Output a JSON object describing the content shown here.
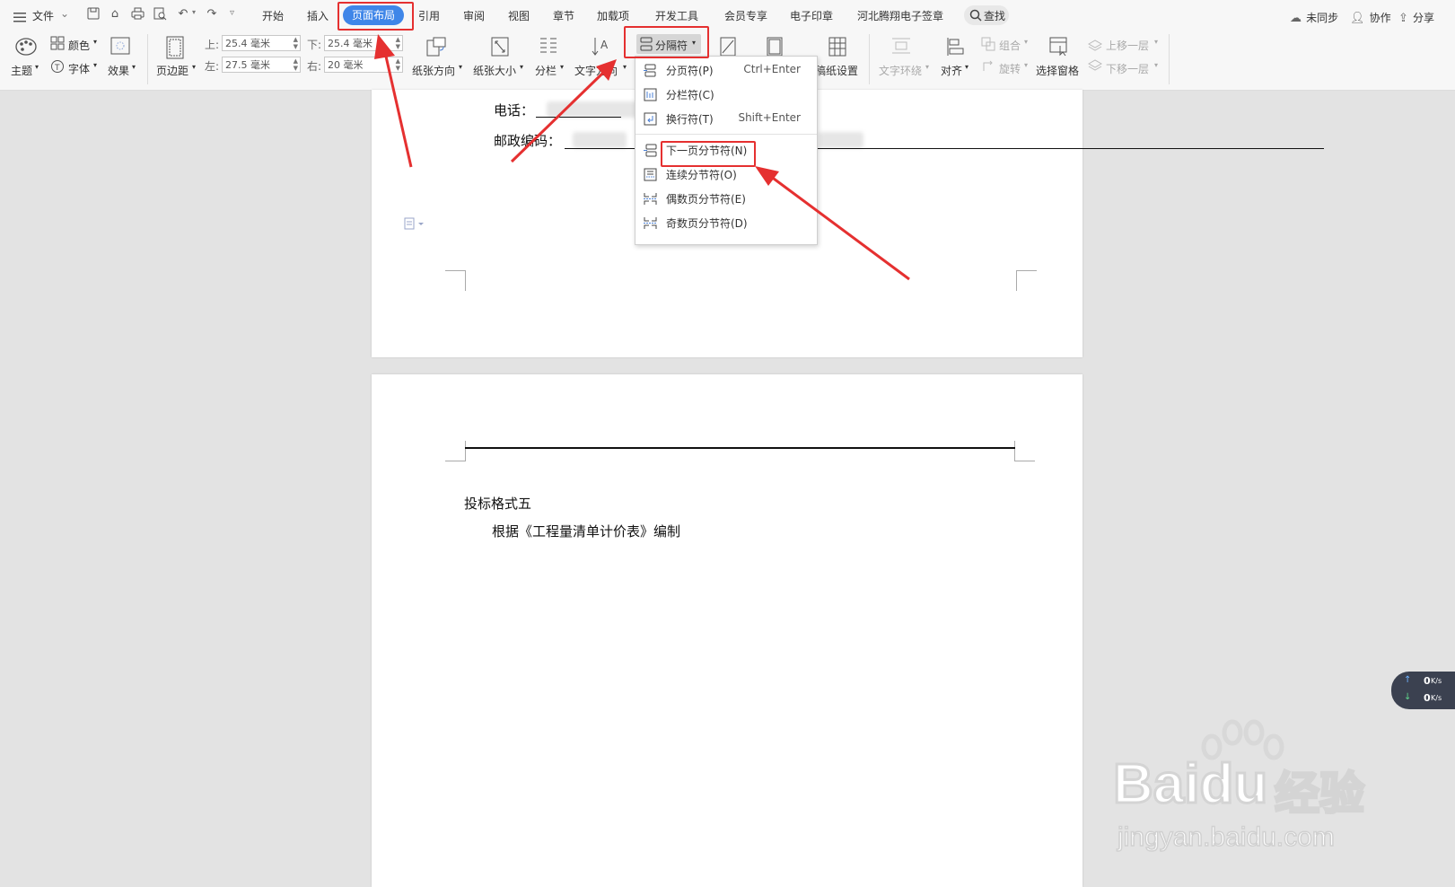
{
  "menubar": {
    "file_label": "文件",
    "tabs": [
      "开始",
      "插入",
      "页面布局",
      "引用",
      "审阅",
      "视图",
      "章节",
      "加载项",
      "开发工具",
      "会员专享",
      "电子印章",
      "河北腾翔电子签章"
    ],
    "active_tab": "页面布局",
    "search_label": "查找",
    "right": {
      "sync": "未同步",
      "collab": "协作",
      "share": "分享"
    }
  },
  "ribbon": {
    "theme": "主题",
    "color": "颜色",
    "font": "字体",
    "effect": "效果",
    "margins": "页边距",
    "margin_top_label": "上:",
    "margin_top": "25.4 毫米",
    "margin_bottom_label": "下:",
    "margin_bottom": "25.4 毫米",
    "margin_left_label": "左:",
    "margin_left": "27.5 毫米",
    "margin_right_label": "右:",
    "margin_right": "20 毫米",
    "orientation": "纸张方向",
    "paper_size": "纸张大小",
    "columns": "分栏",
    "text_direction": "文字方向",
    "breaks": "分隔符",
    "grid_paper": "稿纸设置",
    "text_wrap": "文字环绕",
    "align": "对齐",
    "group": "组合",
    "rotate": "旋转",
    "selection_pane": "选择窗格",
    "bring_forward": "上移一层",
    "send_backward": "下移一层"
  },
  "dropdown": {
    "items": [
      {
        "label": "分页符(P)",
        "shortcut": "Ctrl+Enter"
      },
      {
        "label": "分栏符(C)",
        "shortcut": ""
      },
      {
        "label": "换行符(T)",
        "shortcut": "Shift+Enter"
      },
      {
        "label": "下一页分节符(N)",
        "shortcut": ""
      },
      {
        "label": "连续分节符(O)",
        "shortcut": ""
      },
      {
        "label": "偶数页分节符(E)",
        "shortcut": ""
      },
      {
        "label": "奇数页分节符(D)",
        "shortcut": ""
      }
    ],
    "highlighted": "下一页分节符(N)"
  },
  "document": {
    "page1": {
      "phone_label": "电话：",
      "postcode_label": "邮政编码："
    },
    "page2": {
      "heading": "投标格式五",
      "body": "根据《工程量清单计价表》编制"
    }
  },
  "speed_widget": {
    "upload": "0",
    "download": "0",
    "unit": "K/s"
  },
  "watermark": {
    "brand": "Baidu",
    "brand_cn": "经验",
    "url": "jingyan.baidu.com"
  },
  "colors": {
    "accent": "#3f86e8",
    "annotation_red": "#e53030",
    "page_bg": "#e3e3e3"
  }
}
